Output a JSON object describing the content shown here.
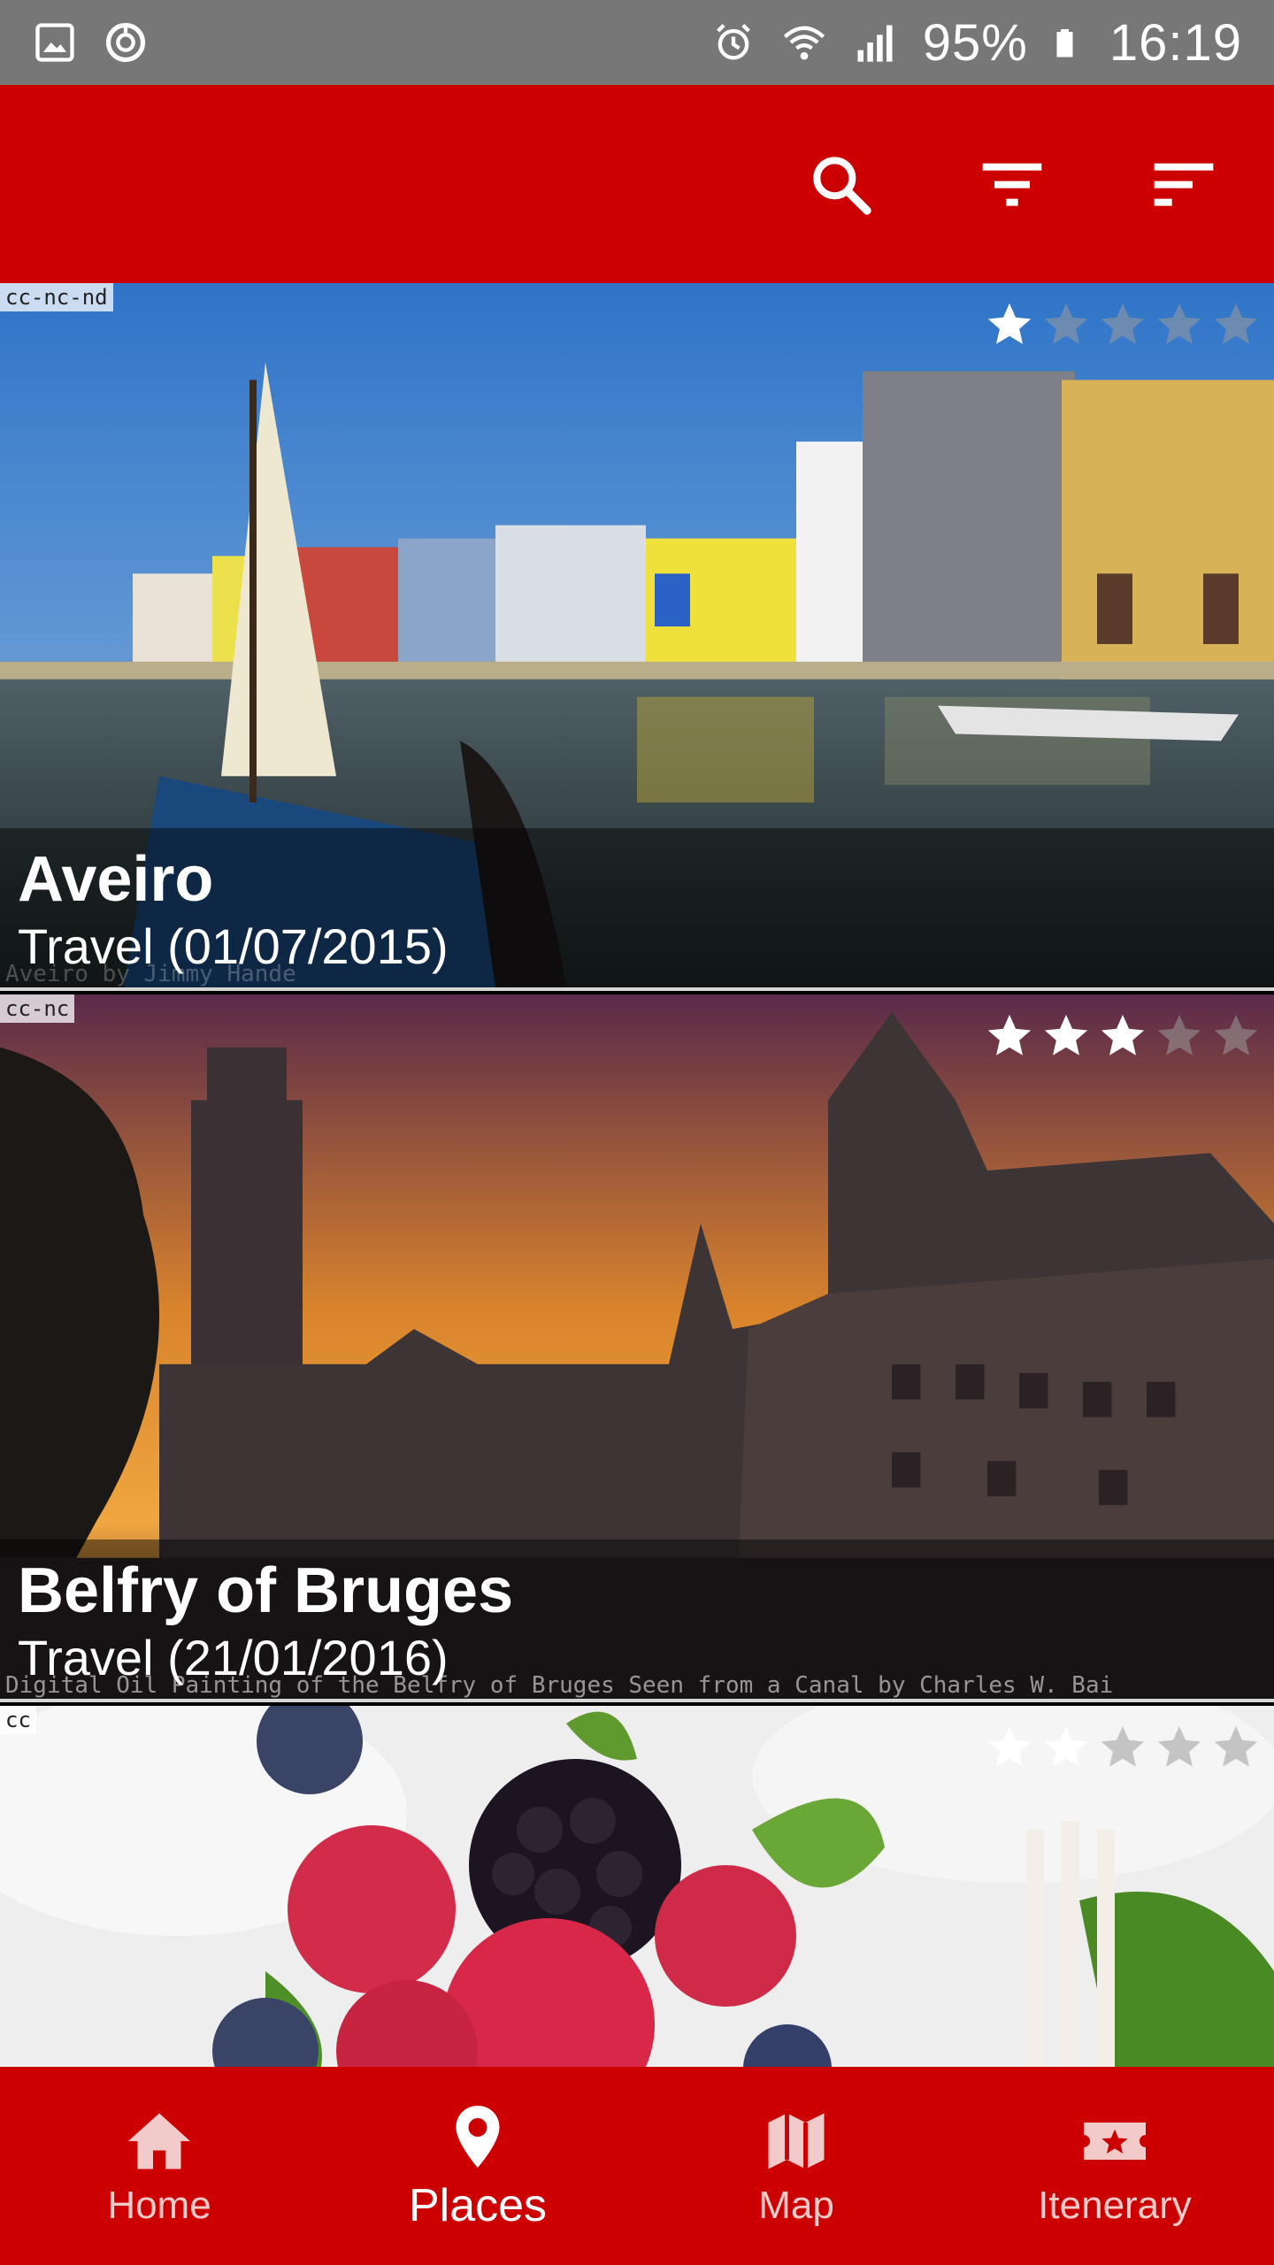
{
  "status_bar": {
    "battery": "95%",
    "time": "16:19"
  },
  "app_bar": {
    "actions": [
      {
        "name": "search-icon"
      },
      {
        "name": "filter-icon"
      },
      {
        "name": "sort-icon"
      }
    ]
  },
  "places": [
    {
      "title": "Aveiro",
      "subtitle": "Travel (01/07/2015)",
      "license": "cc-nc-nd",
      "rating": 1,
      "rating_max": 5,
      "credit": "Aveiro by Jimmy Hande"
    },
    {
      "title": "Belfry of Bruges",
      "subtitle": "Travel (21/01/2016)",
      "license": "cc-nc",
      "rating": 3,
      "rating_max": 5,
      "credit": "Digital Oil Painting of the Belfry of Bruges Seen from a Canal by Charles W. Bai"
    },
    {
      "title": "",
      "subtitle": "",
      "license": "cc",
      "rating": 2,
      "rating_max": 5,
      "credit": ""
    }
  ],
  "bottom_nav": {
    "items": [
      {
        "label": "Home",
        "icon": "home-icon",
        "active": false
      },
      {
        "label": "Places",
        "icon": "place-pin-icon",
        "active": true
      },
      {
        "label": "Map",
        "icon": "map-icon",
        "active": false
      },
      {
        "label": "Itenerary",
        "icon": "itinerary-ticket-icon",
        "active": false
      }
    ]
  },
  "colors": {
    "primary": "#cc0000",
    "status_bar": "#777777",
    "star_active": "#ffffff",
    "star_inactive": "#9a9a9a"
  }
}
